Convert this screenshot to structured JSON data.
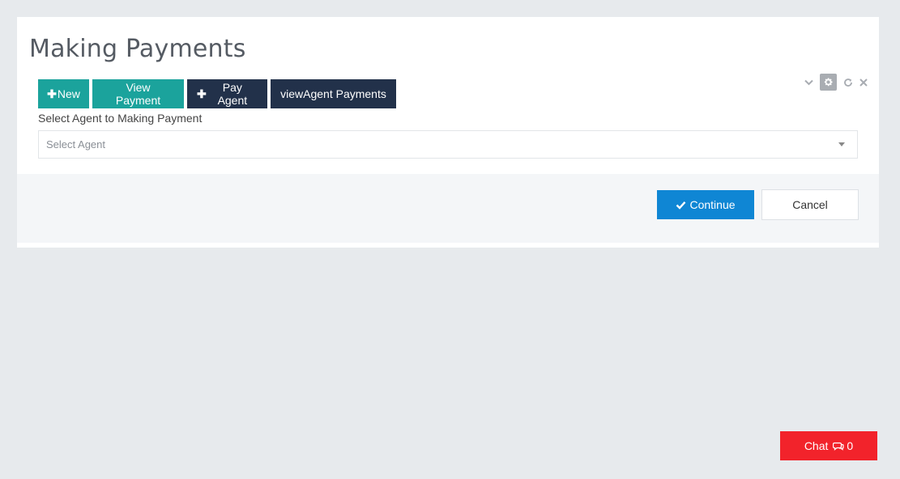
{
  "page": {
    "title": "Making Payments"
  },
  "toolbar": {
    "new_label": "New",
    "view_payment_label": "View Payment",
    "pay_agent_label": "Pay Agent",
    "view_agent_payments_label": "viewAgent Payments"
  },
  "portlet_tools": {
    "collapse_icon": "chevron-down-icon",
    "config_icon": "gear-icon",
    "reload_icon": "refresh-icon",
    "remove_icon": "close-icon"
  },
  "form": {
    "agent_label": "Select Agent to Making Payment",
    "agent_select": {
      "selected": "Select Agent"
    }
  },
  "actions": {
    "continue_label": "Continue",
    "cancel_label": "Cancel"
  },
  "chat": {
    "label": "Chat",
    "count": "0"
  },
  "colors": {
    "teal": "#1ba39c",
    "dark_navy": "#22314a",
    "primary_blue": "#0f86d4",
    "chat_red": "#f2232b",
    "background": "#e7eaed"
  }
}
